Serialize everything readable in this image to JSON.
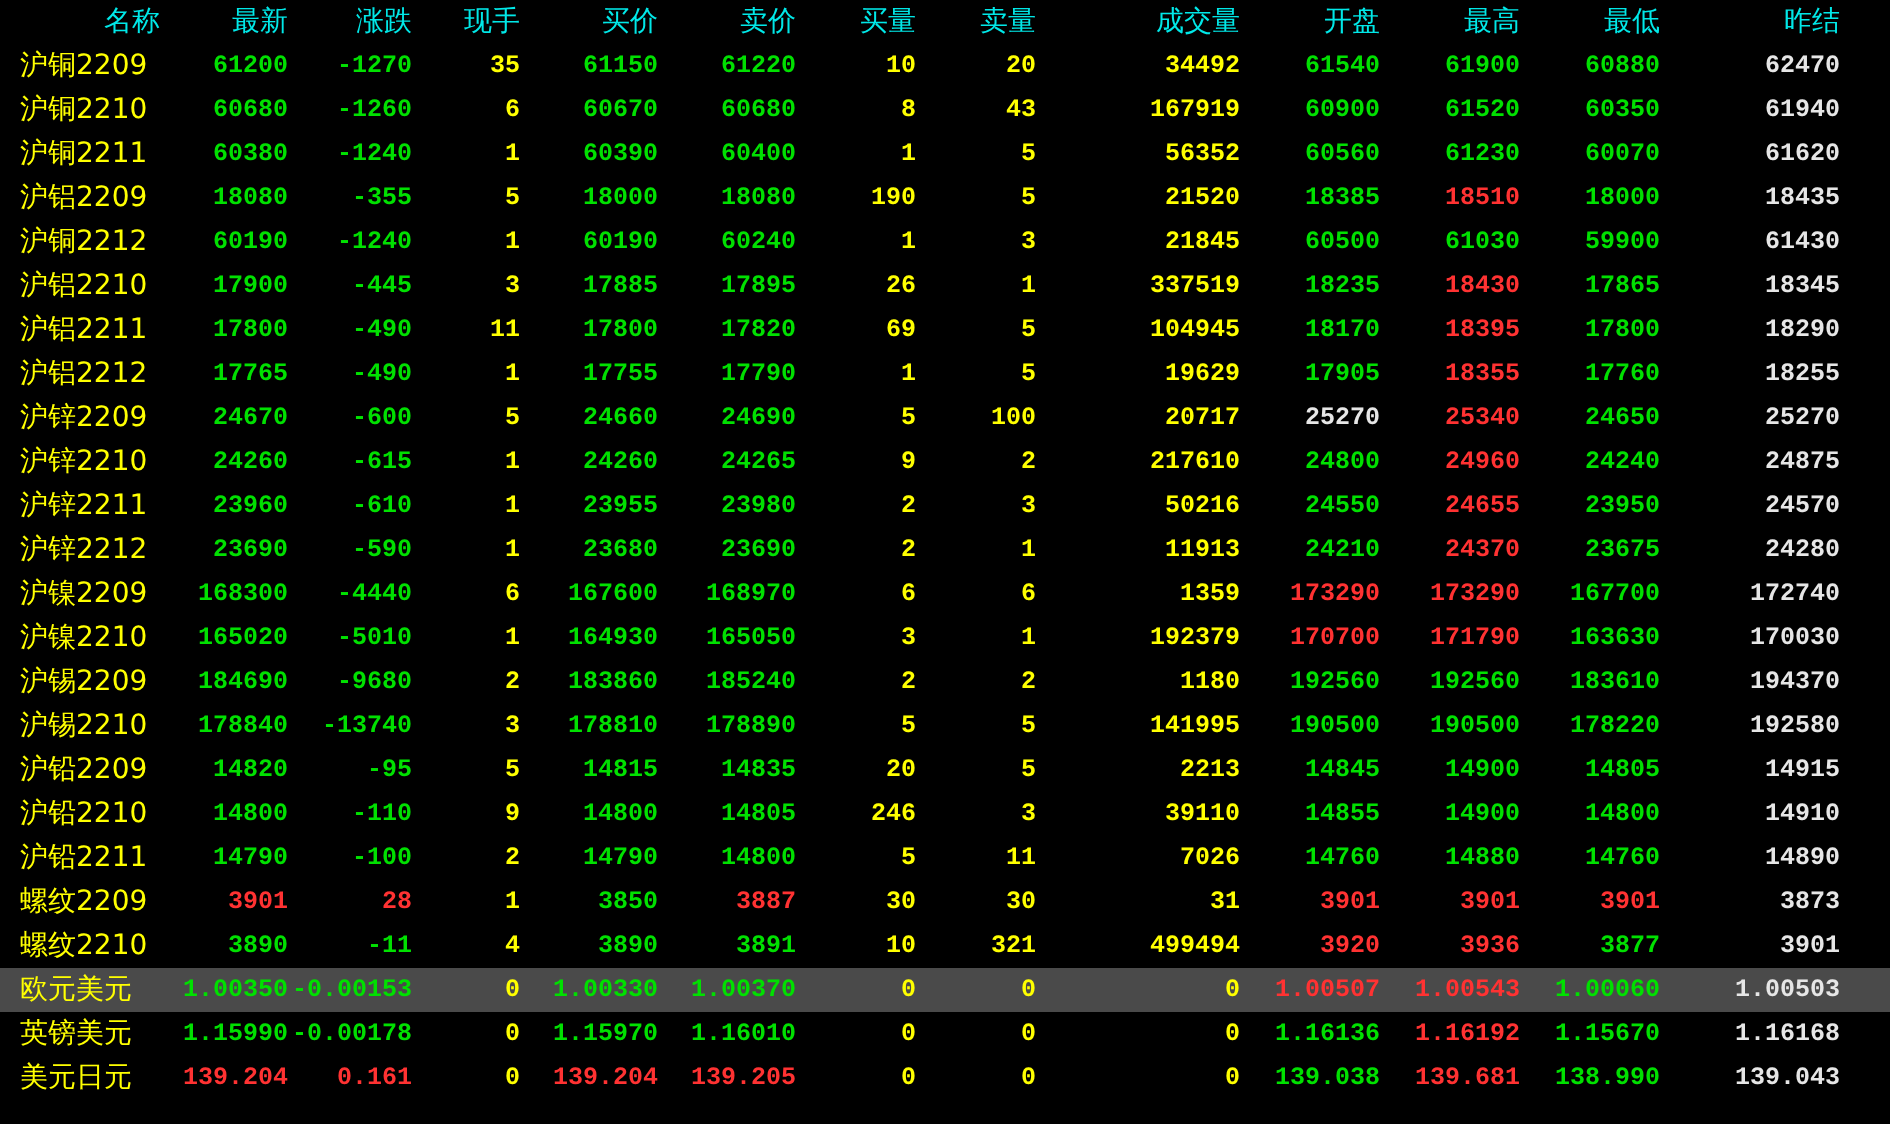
{
  "table": {
    "columns": [
      "名称",
      "最新",
      "涨跌",
      "现手",
      "买价",
      "卖价",
      "买量",
      "卖量",
      "成交量",
      "开盘",
      "最高",
      "最低",
      "昨结"
    ],
    "rows": [
      {
        "selected": false,
        "cells": [
          {
            "text": "沪铜2209",
            "kind": "name"
          },
          {
            "text": "61200",
            "kind": "down"
          },
          {
            "text": "-1270",
            "kind": "down"
          },
          {
            "text": "35",
            "kind": "qty"
          },
          {
            "text": "61150",
            "kind": "down"
          },
          {
            "text": "61220",
            "kind": "down"
          },
          {
            "text": "10",
            "kind": "qty"
          },
          {
            "text": "20",
            "kind": "qty"
          },
          {
            "text": "34492",
            "kind": "qty"
          },
          {
            "text": "61540",
            "kind": "down"
          },
          {
            "text": "61900",
            "kind": "down"
          },
          {
            "text": "60880",
            "kind": "down"
          },
          {
            "text": "62470",
            "kind": "flat"
          }
        ]
      },
      {
        "selected": false,
        "cells": [
          {
            "text": "沪铜2210",
            "kind": "name"
          },
          {
            "text": "60680",
            "kind": "down"
          },
          {
            "text": "-1260",
            "kind": "down"
          },
          {
            "text": "6",
            "kind": "qty"
          },
          {
            "text": "60670",
            "kind": "down"
          },
          {
            "text": "60680",
            "kind": "down"
          },
          {
            "text": "8",
            "kind": "qty"
          },
          {
            "text": "43",
            "kind": "qty"
          },
          {
            "text": "167919",
            "kind": "qty"
          },
          {
            "text": "60900",
            "kind": "down"
          },
          {
            "text": "61520",
            "kind": "down"
          },
          {
            "text": "60350",
            "kind": "down"
          },
          {
            "text": "61940",
            "kind": "flat"
          }
        ]
      },
      {
        "selected": false,
        "cells": [
          {
            "text": "沪铜2211",
            "kind": "name"
          },
          {
            "text": "60380",
            "kind": "down"
          },
          {
            "text": "-1240",
            "kind": "down"
          },
          {
            "text": "1",
            "kind": "qty"
          },
          {
            "text": "60390",
            "kind": "down"
          },
          {
            "text": "60400",
            "kind": "down"
          },
          {
            "text": "1",
            "kind": "qty"
          },
          {
            "text": "5",
            "kind": "qty"
          },
          {
            "text": "56352",
            "kind": "qty"
          },
          {
            "text": "60560",
            "kind": "down"
          },
          {
            "text": "61230",
            "kind": "down"
          },
          {
            "text": "60070",
            "kind": "down"
          },
          {
            "text": "61620",
            "kind": "flat"
          }
        ]
      },
      {
        "selected": false,
        "cells": [
          {
            "text": "沪铝2209",
            "kind": "name"
          },
          {
            "text": "18080",
            "kind": "down"
          },
          {
            "text": "-355",
            "kind": "down"
          },
          {
            "text": "5",
            "kind": "qty"
          },
          {
            "text": "18000",
            "kind": "down"
          },
          {
            "text": "18080",
            "kind": "down"
          },
          {
            "text": "190",
            "kind": "qty"
          },
          {
            "text": "5",
            "kind": "qty"
          },
          {
            "text": "21520",
            "kind": "qty"
          },
          {
            "text": "18385",
            "kind": "down"
          },
          {
            "text": "18510",
            "kind": "up"
          },
          {
            "text": "18000",
            "kind": "down"
          },
          {
            "text": "18435",
            "kind": "flat"
          }
        ]
      },
      {
        "selected": false,
        "cells": [
          {
            "text": "沪铜2212",
            "kind": "name"
          },
          {
            "text": "60190",
            "kind": "down"
          },
          {
            "text": "-1240",
            "kind": "down"
          },
          {
            "text": "1",
            "kind": "qty"
          },
          {
            "text": "60190",
            "kind": "down"
          },
          {
            "text": "60240",
            "kind": "down"
          },
          {
            "text": "1",
            "kind": "qty"
          },
          {
            "text": "3",
            "kind": "qty"
          },
          {
            "text": "21845",
            "kind": "qty"
          },
          {
            "text": "60500",
            "kind": "down"
          },
          {
            "text": "61030",
            "kind": "down"
          },
          {
            "text": "59900",
            "kind": "down"
          },
          {
            "text": "61430",
            "kind": "flat"
          }
        ]
      },
      {
        "selected": false,
        "cells": [
          {
            "text": "沪铝2210",
            "kind": "name"
          },
          {
            "text": "17900",
            "kind": "down"
          },
          {
            "text": "-445",
            "kind": "down"
          },
          {
            "text": "3",
            "kind": "qty"
          },
          {
            "text": "17885",
            "kind": "down"
          },
          {
            "text": "17895",
            "kind": "down"
          },
          {
            "text": "26",
            "kind": "qty"
          },
          {
            "text": "1",
            "kind": "qty"
          },
          {
            "text": "337519",
            "kind": "qty"
          },
          {
            "text": "18235",
            "kind": "down"
          },
          {
            "text": "18430",
            "kind": "up"
          },
          {
            "text": "17865",
            "kind": "down"
          },
          {
            "text": "18345",
            "kind": "flat"
          }
        ]
      },
      {
        "selected": false,
        "cells": [
          {
            "text": "沪铝2211",
            "kind": "name"
          },
          {
            "text": "17800",
            "kind": "down"
          },
          {
            "text": "-490",
            "kind": "down"
          },
          {
            "text": "11",
            "kind": "qty"
          },
          {
            "text": "17800",
            "kind": "down"
          },
          {
            "text": "17820",
            "kind": "down"
          },
          {
            "text": "69",
            "kind": "qty"
          },
          {
            "text": "5",
            "kind": "qty"
          },
          {
            "text": "104945",
            "kind": "qty"
          },
          {
            "text": "18170",
            "kind": "down"
          },
          {
            "text": "18395",
            "kind": "up"
          },
          {
            "text": "17800",
            "kind": "down"
          },
          {
            "text": "18290",
            "kind": "flat"
          }
        ]
      },
      {
        "selected": false,
        "cells": [
          {
            "text": "沪铝2212",
            "kind": "name"
          },
          {
            "text": "17765",
            "kind": "down"
          },
          {
            "text": "-490",
            "kind": "down"
          },
          {
            "text": "1",
            "kind": "qty"
          },
          {
            "text": "17755",
            "kind": "down"
          },
          {
            "text": "17790",
            "kind": "down"
          },
          {
            "text": "1",
            "kind": "qty"
          },
          {
            "text": "5",
            "kind": "qty"
          },
          {
            "text": "19629",
            "kind": "qty"
          },
          {
            "text": "17905",
            "kind": "down"
          },
          {
            "text": "18355",
            "kind": "up"
          },
          {
            "text": "17760",
            "kind": "down"
          },
          {
            "text": "18255",
            "kind": "flat"
          }
        ]
      },
      {
        "selected": false,
        "cells": [
          {
            "text": "沪锌2209",
            "kind": "name"
          },
          {
            "text": "24670",
            "kind": "down"
          },
          {
            "text": "-600",
            "kind": "down"
          },
          {
            "text": "5",
            "kind": "qty"
          },
          {
            "text": "24660",
            "kind": "down"
          },
          {
            "text": "24690",
            "kind": "down"
          },
          {
            "text": "5",
            "kind": "qty"
          },
          {
            "text": "100",
            "kind": "qty"
          },
          {
            "text": "20717",
            "kind": "qty"
          },
          {
            "text": "25270",
            "kind": "flat"
          },
          {
            "text": "25340",
            "kind": "up"
          },
          {
            "text": "24650",
            "kind": "down"
          },
          {
            "text": "25270",
            "kind": "flat"
          }
        ]
      },
      {
        "selected": false,
        "cells": [
          {
            "text": "沪锌2210",
            "kind": "name"
          },
          {
            "text": "24260",
            "kind": "down"
          },
          {
            "text": "-615",
            "kind": "down"
          },
          {
            "text": "1",
            "kind": "qty"
          },
          {
            "text": "24260",
            "kind": "down"
          },
          {
            "text": "24265",
            "kind": "down"
          },
          {
            "text": "9",
            "kind": "qty"
          },
          {
            "text": "2",
            "kind": "qty"
          },
          {
            "text": "217610",
            "kind": "qty"
          },
          {
            "text": "24800",
            "kind": "down"
          },
          {
            "text": "24960",
            "kind": "up"
          },
          {
            "text": "24240",
            "kind": "down"
          },
          {
            "text": "24875",
            "kind": "flat"
          }
        ]
      },
      {
        "selected": false,
        "cells": [
          {
            "text": "沪锌2211",
            "kind": "name"
          },
          {
            "text": "23960",
            "kind": "down"
          },
          {
            "text": "-610",
            "kind": "down"
          },
          {
            "text": "1",
            "kind": "qty"
          },
          {
            "text": "23955",
            "kind": "down"
          },
          {
            "text": "23980",
            "kind": "down"
          },
          {
            "text": "2",
            "kind": "qty"
          },
          {
            "text": "3",
            "kind": "qty"
          },
          {
            "text": "50216",
            "kind": "qty"
          },
          {
            "text": "24550",
            "kind": "down"
          },
          {
            "text": "24655",
            "kind": "up"
          },
          {
            "text": "23950",
            "kind": "down"
          },
          {
            "text": "24570",
            "kind": "flat"
          }
        ]
      },
      {
        "selected": false,
        "cells": [
          {
            "text": "沪锌2212",
            "kind": "name"
          },
          {
            "text": "23690",
            "kind": "down"
          },
          {
            "text": "-590",
            "kind": "down"
          },
          {
            "text": "1",
            "kind": "qty"
          },
          {
            "text": "23680",
            "kind": "down"
          },
          {
            "text": "23690",
            "kind": "down"
          },
          {
            "text": "2",
            "kind": "qty"
          },
          {
            "text": "1",
            "kind": "qty"
          },
          {
            "text": "11913",
            "kind": "qty"
          },
          {
            "text": "24210",
            "kind": "down"
          },
          {
            "text": "24370",
            "kind": "up"
          },
          {
            "text": "23675",
            "kind": "down"
          },
          {
            "text": "24280",
            "kind": "flat"
          }
        ]
      },
      {
        "selected": false,
        "cells": [
          {
            "text": "沪镍2209",
            "kind": "name"
          },
          {
            "text": "168300",
            "kind": "down"
          },
          {
            "text": "-4440",
            "kind": "down"
          },
          {
            "text": "6",
            "kind": "qty"
          },
          {
            "text": "167600",
            "kind": "down"
          },
          {
            "text": "168970",
            "kind": "down"
          },
          {
            "text": "6",
            "kind": "qty"
          },
          {
            "text": "6",
            "kind": "qty"
          },
          {
            "text": "1359",
            "kind": "qty"
          },
          {
            "text": "173290",
            "kind": "up"
          },
          {
            "text": "173290",
            "kind": "up"
          },
          {
            "text": "167700",
            "kind": "down"
          },
          {
            "text": "172740",
            "kind": "flat"
          }
        ]
      },
      {
        "selected": false,
        "cells": [
          {
            "text": "沪镍2210",
            "kind": "name"
          },
          {
            "text": "165020",
            "kind": "down"
          },
          {
            "text": "-5010",
            "kind": "down"
          },
          {
            "text": "1",
            "kind": "qty"
          },
          {
            "text": "164930",
            "kind": "down"
          },
          {
            "text": "165050",
            "kind": "down"
          },
          {
            "text": "3",
            "kind": "qty"
          },
          {
            "text": "1",
            "kind": "qty"
          },
          {
            "text": "192379",
            "kind": "qty"
          },
          {
            "text": "170700",
            "kind": "up"
          },
          {
            "text": "171790",
            "kind": "up"
          },
          {
            "text": "163630",
            "kind": "down"
          },
          {
            "text": "170030",
            "kind": "flat"
          }
        ]
      },
      {
        "selected": false,
        "cells": [
          {
            "text": "沪锡2209",
            "kind": "name"
          },
          {
            "text": "184690",
            "kind": "down"
          },
          {
            "text": "-9680",
            "kind": "down"
          },
          {
            "text": "2",
            "kind": "qty"
          },
          {
            "text": "183860",
            "kind": "down"
          },
          {
            "text": "185240",
            "kind": "down"
          },
          {
            "text": "2",
            "kind": "qty"
          },
          {
            "text": "2",
            "kind": "qty"
          },
          {
            "text": "1180",
            "kind": "qty"
          },
          {
            "text": "192560",
            "kind": "down"
          },
          {
            "text": "192560",
            "kind": "down"
          },
          {
            "text": "183610",
            "kind": "down"
          },
          {
            "text": "194370",
            "kind": "flat"
          }
        ]
      },
      {
        "selected": false,
        "cells": [
          {
            "text": "沪锡2210",
            "kind": "name"
          },
          {
            "text": "178840",
            "kind": "down"
          },
          {
            "text": "-13740",
            "kind": "down"
          },
          {
            "text": "3",
            "kind": "qty"
          },
          {
            "text": "178810",
            "kind": "down"
          },
          {
            "text": "178890",
            "kind": "down"
          },
          {
            "text": "5",
            "kind": "qty"
          },
          {
            "text": "5",
            "kind": "qty"
          },
          {
            "text": "141995",
            "kind": "qty"
          },
          {
            "text": "190500",
            "kind": "down"
          },
          {
            "text": "190500",
            "kind": "down"
          },
          {
            "text": "178220",
            "kind": "down"
          },
          {
            "text": "192580",
            "kind": "flat"
          }
        ]
      },
      {
        "selected": false,
        "cells": [
          {
            "text": "沪铅2209",
            "kind": "name"
          },
          {
            "text": "14820",
            "kind": "down"
          },
          {
            "text": "-95",
            "kind": "down"
          },
          {
            "text": "5",
            "kind": "qty"
          },
          {
            "text": "14815",
            "kind": "down"
          },
          {
            "text": "14835",
            "kind": "down"
          },
          {
            "text": "20",
            "kind": "qty"
          },
          {
            "text": "5",
            "kind": "qty"
          },
          {
            "text": "2213",
            "kind": "qty"
          },
          {
            "text": "14845",
            "kind": "down"
          },
          {
            "text": "14900",
            "kind": "down"
          },
          {
            "text": "14805",
            "kind": "down"
          },
          {
            "text": "14915",
            "kind": "flat"
          }
        ]
      },
      {
        "selected": false,
        "cells": [
          {
            "text": "沪铅2210",
            "kind": "name"
          },
          {
            "text": "14800",
            "kind": "down"
          },
          {
            "text": "-110",
            "kind": "down"
          },
          {
            "text": "9",
            "kind": "qty"
          },
          {
            "text": "14800",
            "kind": "down"
          },
          {
            "text": "14805",
            "kind": "down"
          },
          {
            "text": "246",
            "kind": "qty"
          },
          {
            "text": "3",
            "kind": "qty"
          },
          {
            "text": "39110",
            "kind": "qty"
          },
          {
            "text": "14855",
            "kind": "down"
          },
          {
            "text": "14900",
            "kind": "down"
          },
          {
            "text": "14800",
            "kind": "down"
          },
          {
            "text": "14910",
            "kind": "flat"
          }
        ]
      },
      {
        "selected": false,
        "cells": [
          {
            "text": "沪铅2211",
            "kind": "name"
          },
          {
            "text": "14790",
            "kind": "down"
          },
          {
            "text": "-100",
            "kind": "down"
          },
          {
            "text": "2",
            "kind": "qty"
          },
          {
            "text": "14790",
            "kind": "down"
          },
          {
            "text": "14800",
            "kind": "down"
          },
          {
            "text": "5",
            "kind": "qty"
          },
          {
            "text": "11",
            "kind": "qty"
          },
          {
            "text": "7026",
            "kind": "qty"
          },
          {
            "text": "14760",
            "kind": "down"
          },
          {
            "text": "14880",
            "kind": "down"
          },
          {
            "text": "14760",
            "kind": "down"
          },
          {
            "text": "14890",
            "kind": "flat"
          }
        ]
      },
      {
        "selected": false,
        "cells": [
          {
            "text": "螺纹2209",
            "kind": "name"
          },
          {
            "text": "3901",
            "kind": "up"
          },
          {
            "text": "28",
            "kind": "up"
          },
          {
            "text": "1",
            "kind": "qty"
          },
          {
            "text": "3850",
            "kind": "down"
          },
          {
            "text": "3887",
            "kind": "up"
          },
          {
            "text": "30",
            "kind": "qty"
          },
          {
            "text": "30",
            "kind": "qty"
          },
          {
            "text": "31",
            "kind": "qty"
          },
          {
            "text": "3901",
            "kind": "up"
          },
          {
            "text": "3901",
            "kind": "up"
          },
          {
            "text": "3901",
            "kind": "up"
          },
          {
            "text": "3873",
            "kind": "flat"
          }
        ]
      },
      {
        "selected": false,
        "cells": [
          {
            "text": "螺纹2210",
            "kind": "name"
          },
          {
            "text": "3890",
            "kind": "down"
          },
          {
            "text": "-11",
            "kind": "down"
          },
          {
            "text": "4",
            "kind": "qty"
          },
          {
            "text": "3890",
            "kind": "down"
          },
          {
            "text": "3891",
            "kind": "down"
          },
          {
            "text": "10",
            "kind": "qty"
          },
          {
            "text": "321",
            "kind": "qty"
          },
          {
            "text": "499494",
            "kind": "qty"
          },
          {
            "text": "3920",
            "kind": "up"
          },
          {
            "text": "3936",
            "kind": "up"
          },
          {
            "text": "3877",
            "kind": "down"
          },
          {
            "text": "3901",
            "kind": "flat"
          }
        ]
      },
      {
        "selected": true,
        "cells": [
          {
            "text": "欧元美元",
            "kind": "name"
          },
          {
            "text": "1.00350",
            "kind": "down"
          },
          {
            "text": "-0.00153",
            "kind": "down"
          },
          {
            "text": "0",
            "kind": "qty"
          },
          {
            "text": "1.00330",
            "kind": "down"
          },
          {
            "text": "1.00370",
            "kind": "down"
          },
          {
            "text": "0",
            "kind": "qty"
          },
          {
            "text": "0",
            "kind": "qty"
          },
          {
            "text": "0",
            "kind": "qty"
          },
          {
            "text": "1.00507",
            "kind": "up"
          },
          {
            "text": "1.00543",
            "kind": "up"
          },
          {
            "text": "1.00060",
            "kind": "down"
          },
          {
            "text": "1.00503",
            "kind": "flat"
          }
        ]
      },
      {
        "selected": false,
        "cells": [
          {
            "text": "英镑美元",
            "kind": "name"
          },
          {
            "text": "1.15990",
            "kind": "down"
          },
          {
            "text": "-0.00178",
            "kind": "down"
          },
          {
            "text": "0",
            "kind": "qty"
          },
          {
            "text": "1.15970",
            "kind": "down"
          },
          {
            "text": "1.16010",
            "kind": "down"
          },
          {
            "text": "0",
            "kind": "qty"
          },
          {
            "text": "0",
            "kind": "qty"
          },
          {
            "text": "0",
            "kind": "qty"
          },
          {
            "text": "1.16136",
            "kind": "down"
          },
          {
            "text": "1.16192",
            "kind": "up"
          },
          {
            "text": "1.15670",
            "kind": "down"
          },
          {
            "text": "1.16168",
            "kind": "flat"
          }
        ]
      },
      {
        "selected": false,
        "cells": [
          {
            "text": "美元日元",
            "kind": "name"
          },
          {
            "text": "139.204",
            "kind": "up"
          },
          {
            "text": "0.161",
            "kind": "up"
          },
          {
            "text": "0",
            "kind": "qty"
          },
          {
            "text": "139.204",
            "kind": "up"
          },
          {
            "text": "139.205",
            "kind": "up"
          },
          {
            "text": "0",
            "kind": "qty"
          },
          {
            "text": "0",
            "kind": "qty"
          },
          {
            "text": "0",
            "kind": "qty"
          },
          {
            "text": "139.038",
            "kind": "down"
          },
          {
            "text": "139.681",
            "kind": "up"
          },
          {
            "text": "138.990",
            "kind": "down"
          },
          {
            "text": "139.043",
            "kind": "flat"
          }
        ]
      }
    ]
  }
}
